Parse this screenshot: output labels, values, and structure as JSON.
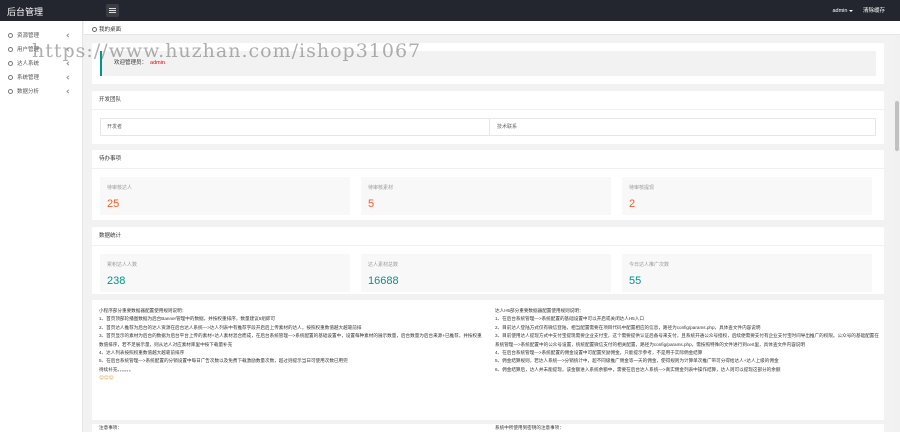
{
  "header": {
    "brand": "后台管理",
    "user": "admin",
    "clear_cache": "清除缓存"
  },
  "sidebar": {
    "items": [
      {
        "label": "资源管理",
        "icon": "folder-icon"
      },
      {
        "label": "用户管理",
        "icon": "user-icon"
      },
      {
        "label": "达人系统",
        "icon": "star-icon"
      },
      {
        "label": "系统管理",
        "icon": "gear-icon"
      },
      {
        "label": "数据分析",
        "icon": "chart-icon"
      }
    ]
  },
  "tabs": {
    "home": "我的桌面"
  },
  "welcome": {
    "prefix": "欢迎管理员：",
    "name": "admin"
  },
  "team": {
    "title": "开发团队",
    "developer_label": "开发者",
    "contact_label": "技术联系"
  },
  "todo": {
    "title": "待办事项",
    "items": [
      {
        "label": "待审核达人",
        "value": "25"
      },
      {
        "label": "待审核素材",
        "value": "5"
      },
      {
        "label": "待审核提现",
        "value": "2"
      }
    ]
  },
  "stats": {
    "title": "数据统计",
    "items": [
      {
        "label": "累积达人人数",
        "value": "238"
      },
      {
        "label": "达人素材总数",
        "value": "16688"
      },
      {
        "label": "今日达人推广次数",
        "value": "55"
      }
    ]
  },
  "notes": {
    "left_title": "小程序部分重要数据器配置使用规则说明：",
    "left_lines": [
      "1、首页顶部轮播图数据为后台Banner管理中的数据，并按权重排序，数量建议5组即可",
      "2、首页达人推荐为后台的达人资源在后台达人系统—>达人列表中有推荐字段开启后上传素材的达人，按照权重数值越大越靠前排",
      "3、首页显示的素材为后台的数据为后台平台上传的素材+达人素材混合而成，在后台系统管理—>系统配置的基础设置中，设置每种素材的展示数量，后台数量为后台来源+已推荐，并按权重数值排序，若不足展示量，则从达人对应素材库里中按下载量补充",
      "4、达人列表按照权重数值越大越靠前排序",
      "5、在后台系统管理—>系统配置的分销设置中每日广告次数以及免费下载激励数量次数，超过则提示当日可使用次数已用完",
      "待续补充。。。。。。",
      "😊😊😊"
    ],
    "right_title": "达人H5部分重要数据器配置使用规则说明：",
    "right_lines": [
      "1、在后台系统管理—>系统配置的基础设置中可以开启或关闭达人H5入口",
      "2、目前达人登陆方式仅有微信登陆，相当配置需要在项目代码中配置相应的信息，路径为config/params.php，具体查文件内容说明",
      "3、目前使用达人提现方式中支付宝提现需要企业支付宝，这个需要提供认证后备号来支付，且系统开通公众号授权，后续便需要支付有企业支付宝时间导出推广的权限。公众号的基础配置在系统管理—>系统配置中的公众号设置，统统配置微信支付的相关配置，路径为config/params.php，需按照特殊的文件进行到cert里，具体查文件内容说明",
      "4、在后台系统管理—>系统配置的佣金设置中可配置奖励佣金，只能提示参考，不是用于实际佣金结算",
      "5、佣金结算规则，若达人系统—>分销统计中，超不同级推广佣金等一天的佣金，使得规则为计算单次推广带可分得给达人+达人上级的佣金",
      "6、佣金结算后，达人并未能提现，该金额进入系统余额中，需要在后台达人系统—>真实佣金列表中操作结算，达人则可以提现这部分的余额"
    ]
  },
  "bottom": {
    "left": "注意事项：",
    "right": "系统中所使用到密钥的注意事项："
  },
  "watermark": "https://www.huzhan.com/ishop31067"
}
